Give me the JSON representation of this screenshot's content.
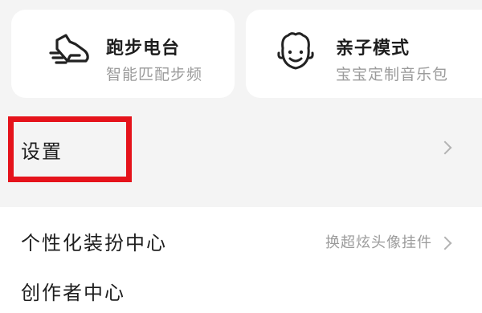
{
  "cards": [
    {
      "title": "跑步电台",
      "subtitle": "智能匹配步频",
      "icon": "running-shoe-icon"
    },
    {
      "title": "亲子模式",
      "subtitle": "宝宝定制音乐包",
      "icon": "child-face-icon"
    }
  ],
  "settings": {
    "label": "设置",
    "icon": "chevron-right-icon"
  },
  "menu": [
    {
      "label": "个性化装扮中心",
      "hint": "换超炫头像挂件",
      "icon": "chevron-right-icon"
    },
    {
      "label": "创作者中心"
    }
  ],
  "colors": {
    "background": "#f4f4f4",
    "card": "#ffffff",
    "highlight": "#e5131b",
    "secondary_text": "#9b9b9b"
  }
}
